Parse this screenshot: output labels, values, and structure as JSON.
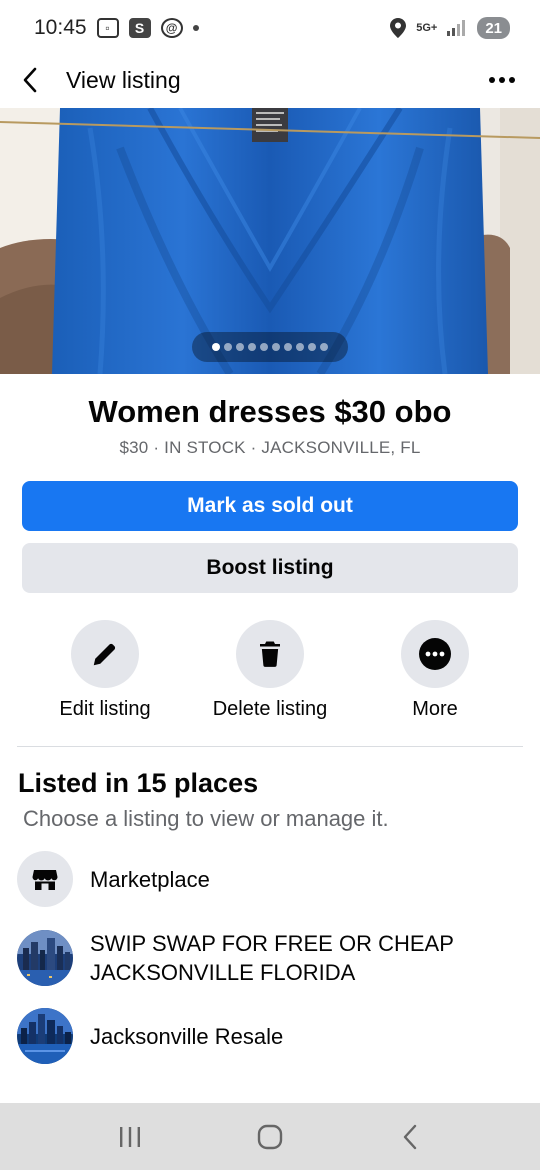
{
  "status_bar": {
    "time": "10:45",
    "network": "5G+",
    "battery": "21"
  },
  "header": {
    "title": "View listing"
  },
  "listing": {
    "title": "Women dresses $30 obo",
    "meta": "$30 · IN STOCK · JACKSONVILLE, FL",
    "photo_count": 10,
    "photo_index": 1
  },
  "buttons": {
    "primary": "Mark as sold out",
    "secondary": "Boost listing"
  },
  "actions": [
    {
      "label": "Edit listing",
      "icon": "pencil-icon"
    },
    {
      "label": "Delete listing",
      "icon": "trash-icon"
    },
    {
      "label": "More",
      "icon": "more-icon"
    }
  ],
  "places": {
    "title": "Listed in 15 places",
    "subtitle": "Choose a listing to view or manage it.",
    "items": [
      {
        "label": "Marketplace",
        "icon": "marketplace-icon"
      },
      {
        "label": "SWIP SWAP FOR FREE OR CHEAP JACKSONVILLE FLORIDA",
        "icon": "group-avatar"
      },
      {
        "label": "Jacksonville Resale",
        "icon": "group-avatar"
      }
    ]
  },
  "colors": {
    "primary": "#1877f2",
    "secondary_bg": "#e4e6eb",
    "dress_blue": "#1f66c6"
  }
}
